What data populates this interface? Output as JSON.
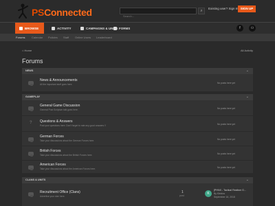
{
  "header": {
    "logo_prefix": "PS",
    "logo_main": "Connected",
    "search_placeholder": "Search...",
    "login_label": "Existing user? Sign In  ▾",
    "signup_label": "SIGN UP"
  },
  "nav": {
    "tabs": [
      {
        "label": "Browse",
        "icon": "browse-icon"
      },
      {
        "label": "Activity",
        "icon": "activity-icon"
      },
      {
        "label": "Campaigns & Units",
        "icon": "campaigns-icon"
      },
      {
        "label": "Forms",
        "icon": "forms-icon"
      }
    ],
    "social": [
      "f",
      "⚇"
    ],
    "subnav": [
      "Forums",
      "Calendar",
      "Policies",
      "Staff",
      "Online Users",
      "Leaderboard"
    ]
  },
  "breadcrumb": {
    "home": "⌂ Home",
    "activity": "All Activity"
  },
  "page_title": "Forums",
  "categories": [
    {
      "title": "News",
      "forums": [
        {
          "name": "News & Announcements",
          "desc": "All the important stuff goes here.",
          "latest": "No posts here yet"
        }
      ]
    },
    {
      "title": "Gameplay",
      "forums": [
        {
          "name": "General Game Discussion",
          "desc": "General Post Scriptum talk goes here.",
          "latest": "No posts here yet"
        },
        {
          "name": "Questions & Answers",
          "desc": "Post your questions here. Don't forget to rate any good answers !!",
          "latest": "No posts here yet"
        },
        {
          "name": "German Forces",
          "desc": "Take your discussions about the German Forces here.",
          "latest": "No posts here yet"
        },
        {
          "name": "British Forces",
          "desc": "Take your discussions about the British Forces here.",
          "latest": "No posts here yet"
        },
        {
          "name": "American Forces",
          "desc": "Take your discussions about the American Forces here.",
          "latest": "No posts here yet"
        }
      ]
    },
    {
      "title": "Clans & Units",
      "forums": [
        {
          "name": "Recruitment Office (Clans)",
          "desc": "Advertise your clan here.",
          "posts": "1",
          "posts_label": "post",
          "latest_avatar": "K",
          "latest_title": "[PHNX - Tactical Realism G...",
          "latest_by": "By Kleidos",
          "latest_date": "September 16, 2018"
        }
      ]
    }
  ],
  "colors": {
    "accent": "#e8591a",
    "avatar": "#3fa88a"
  }
}
